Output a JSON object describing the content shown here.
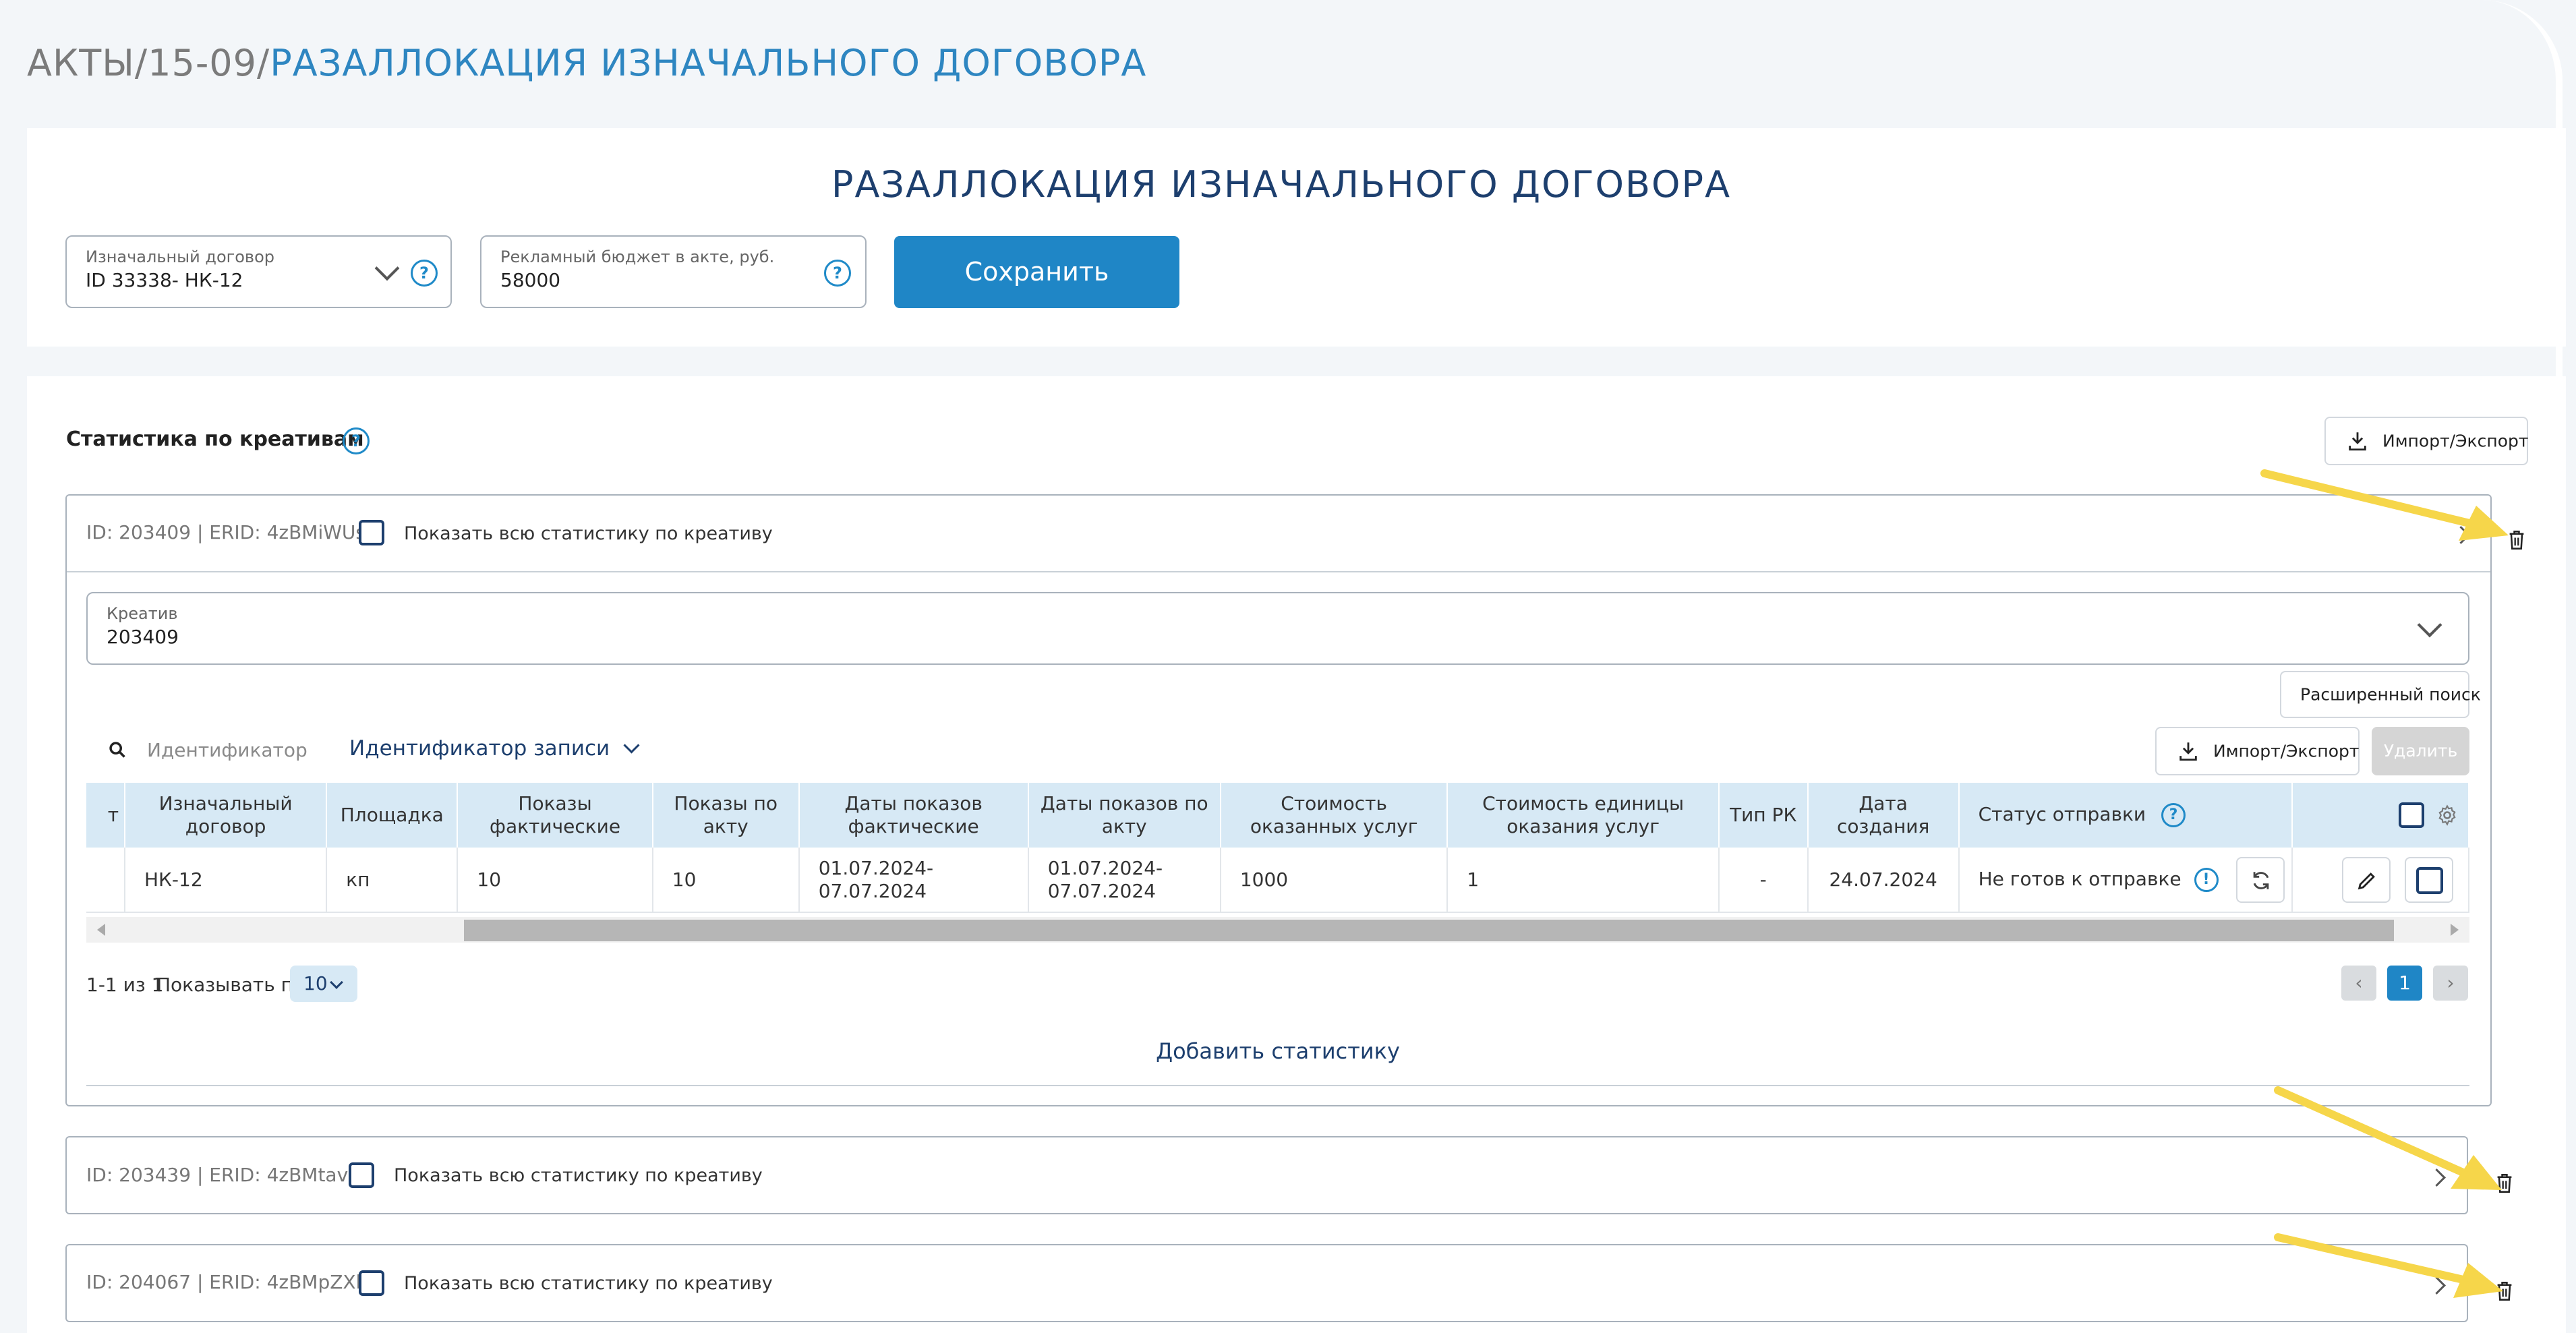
{
  "breadcrumb": {
    "parent": "АКТЫ/15-09/",
    "current": "РАЗАЛЛОКАЦИЯ ИЗНАЧАЛЬНОГО ДОГОВОРА"
  },
  "page_title": "РАЗАЛЛОКАЦИЯ ИЗНАЧАЛЬНОГО ДОГОВОРА",
  "form": {
    "contract": {
      "label": "Изначальный договор",
      "value": "ID 33338- НК-12"
    },
    "budget": {
      "label": "Рекламный бюджет в акте, руб.",
      "value": "58000"
    },
    "save_label": "Сохранить"
  },
  "section": {
    "title": "Статистика по креативам",
    "import_export_label": "Импорт/Экспорт"
  },
  "creatives": [
    {
      "header": "ID: 203409 | ERID: 4zBMiWUs",
      "show_all_label": "Показать всю статистику по креативу"
    },
    {
      "header": "ID: 203439 | ERID: 4zBMtavo",
      "show_all_label": "Показать всю статистику по креативу"
    },
    {
      "header": "ID: 204067 | ERID: 4zBMpZXh",
      "show_all_label": "Показать всю статистику по креативу"
    }
  ],
  "expanded": {
    "creative_select": {
      "label": "Креатив",
      "value": "203409"
    },
    "advanced_search_label": "Расширенный поиск",
    "search_placeholder": "Идентификатор записи",
    "filter_field_label": "Идентификатор записи",
    "import_export_label": "Импорт/Экспорт",
    "delete_label": "Удалить",
    "columns": {
      "truncated": "т",
      "contract": "Изначальный договор",
      "platform": "Площадка",
      "actual_shows": "Показы фактические",
      "act_shows": "Показы по акту",
      "actual_dates": "Даты показов фактические",
      "act_dates": "Даты показов по акту",
      "cost": "Стоимость оказанных услуг",
      "unit_cost": "Стоимость единицы оказания услуг",
      "rk_type": "Тип РК",
      "created": "Дата создания",
      "status": "Статус отправки"
    },
    "rows": [
      {
        "contract": "НК-12",
        "platform": "кп",
        "actual_shows": "10",
        "act_shows": "10",
        "actual_dates": "01.07.2024-07.07.2024",
        "act_dates": "01.07.2024-07.07.2024",
        "cost": "1000",
        "unit_cost": "1",
        "rk_type": "-",
        "created": "24.07.2024",
        "status": "Не готов к отправке"
      }
    ],
    "pagination": {
      "range": "1-1 из 1",
      "per_page_label": "Показывать по",
      "per_page_value": "10",
      "current_page": "1"
    },
    "add_stat_label": "Добавить статистику"
  },
  "colors": {
    "accent": "#1f86c6",
    "title_navy": "#1d3f6e",
    "header_bg": "#d7e9f5",
    "arrow_yellow": "#f6d64a"
  }
}
